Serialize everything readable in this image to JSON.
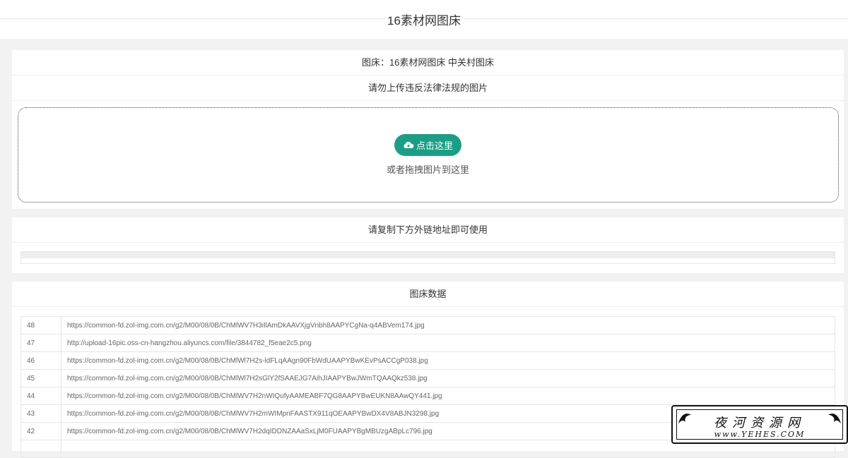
{
  "header": {
    "title": "16素材网图床"
  },
  "upload_card": {
    "host_label": "图床：16素材网图床  中关村图床",
    "warning": "请勿上传违反法律法规的图片",
    "button_label": "点击这里",
    "drag_hint": "或者拖拽图片到这里"
  },
  "link_card": {
    "title": "请复制下方外链地址即可使用"
  },
  "data_card": {
    "title": "图床数据",
    "rows": [
      {
        "id": "48",
        "url": "https://common-fd.zol-img.com.cn/g2/M00/08/0B/ChMlWV7H3iIlAmDkAAVXjgVnbh8AAPYCgNa-q4ABVem174.jpg"
      },
      {
        "id": "47",
        "url": "http://upload-16pic.oss-cn-hangzhou.aliyuncs.com/file/3844782_f5eae2c5.png"
      },
      {
        "id": "46",
        "url": "https://common-fd.zol-img.com.cn/g2/M00/08/0B/ChMlWl7H2s-ldFLqAAgn90FbWdUAAPYBwKEvPsACCgP038.jpg"
      },
      {
        "id": "45",
        "url": "https://common-fd.zol-img.com.cn/g2/M00/08/0B/ChMlWl7H2sGlY2fSAAEJG7AihJIAAPYBwJWmTQAAQkz538.jpg"
      },
      {
        "id": "44",
        "url": "https://common-fd.zol-img.com.cn/g2/M00/08/0B/ChMlWV7H2nWIQufyAAMEABF7QG8AAPYBwEUKN8AAwQY441.jpg"
      },
      {
        "id": "43",
        "url": "https://common-fd.zol-img.com.cn/g2/M00/08/0B/ChMlWV7H2mWIMpnFAASTX911qOEAAPYBwDX4V8ABJN3298.jpg"
      },
      {
        "id": "42",
        "url": "https://common-fd.zol-img.com.cn/g2/M00/08/0B/ChMlWV7H2dqIDDNZAAaSxLjM0FUAAPYBgMBUzgABpLc796.jpg"
      },
      {
        "id": "",
        "url": ""
      }
    ]
  },
  "watermark": {
    "name": "夜河资源网",
    "site": "www.YEHES.COM"
  },
  "colors": {
    "accent": "#1b9e85",
    "background": "#f2f2f2"
  }
}
